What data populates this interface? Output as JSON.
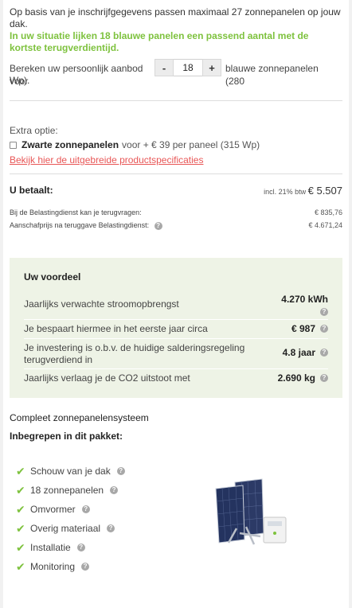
{
  "intro": {
    "line1": "Op basis van je inschrijfgegevens passen maximaal 27 zonnepanelen op jouw dak.",
    "highlight": "In uw situatie lijken 18 blauwe panelen een passend aantal met de kortste terugverdientijd."
  },
  "calculator": {
    "label": "Bereken uw persoonlijk aanbod voor",
    "minus": "-",
    "plus": "+",
    "value": "18",
    "suffix": "blauwe zonnepanelen (280",
    "suffix2": "Wp)."
  },
  "extra": {
    "title": "Extra optie:",
    "option_bold": "Zwarte zonnepanelen",
    "option_rest": "voor + € 39 per paneel (315 Wp)",
    "link": "Bekijk hier de uitgebreide productspecificaties"
  },
  "payment": {
    "label": "U betaalt:",
    "incl": "incl. 21% btw",
    "total": "€ 5.507",
    "refund_label": "Bij de Belastingdienst kan je terugvragen:",
    "refund_value": "€ 835,76",
    "net_label": "Aanschafprijs na teruggave Belastingdienst:",
    "net_value": "€ 4.671,24"
  },
  "voordeel": {
    "title": "Uw voordeel",
    "rows": [
      {
        "label": "Jaarlijks verwachte stroomopbrengst",
        "value": "4.270 kWh"
      },
      {
        "label": "Je bespaart hiermee in het eerste jaar circa",
        "value": "€ 987"
      },
      {
        "label": "Je investering is o.b.v. de huidige salderingsregeling terugverdiend in",
        "value": "4.8 jaar"
      },
      {
        "label": "Jaarlijks verlaag je de CO2 uitstoot met",
        "value": "2.690 kg"
      }
    ]
  },
  "pakket": {
    "title": "Compleet zonnepanelensysteem",
    "subtitle": "Inbegrepen in dit pakket:",
    "items": [
      "Schouw van je dak",
      "18 zonnepanelen",
      "Omvormer",
      "Overig materiaal",
      "Installatie",
      "Monitoring"
    ]
  },
  "colors": {
    "accent_green": "#7ec23e",
    "link_red": "#e85656",
    "panel_bg": "#eef3e6"
  },
  "icons": {
    "help": "question-circle-icon",
    "check": "checkmark-icon"
  }
}
